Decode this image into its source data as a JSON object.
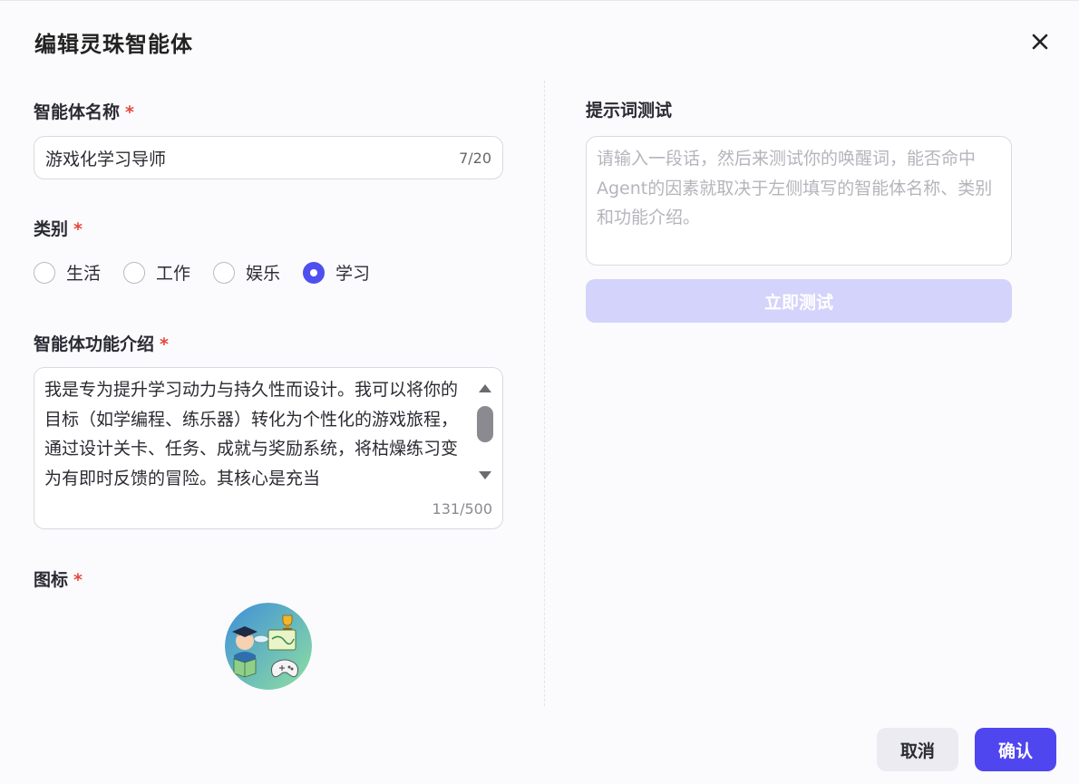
{
  "dialog": {
    "title": "编辑灵珠智能体",
    "close_icon": "close-icon"
  },
  "form": {
    "name": {
      "label": "智能体名称",
      "required_mark": "*",
      "value": "游戏化学习导师",
      "counter": "7/20"
    },
    "category": {
      "label": "类别",
      "required_mark": "*",
      "options": [
        "生活",
        "工作",
        "娱乐",
        "学习"
      ],
      "selected": "学习"
    },
    "description": {
      "label": "智能体功能介绍",
      "required_mark": "*",
      "value": "我是专为提升学习动力与持久性而设计。我可以将你的目标（如学编程、练乐器）转化为个性化的游戏旅程，通过设计关卡、任务、成就与奖励系统，将枯燥练习变为有即时反馈的冒险。其核心是充当",
      "counter": "131/500"
    },
    "icon": {
      "label": "图标",
      "required_mark": "*",
      "image": "avatar-graduate-gaming-illustration"
    }
  },
  "prompt_test": {
    "label": "提示词测试",
    "placeholder": "请输入一段话，然后来测试你的唤醒词，能否命中Agent的因素就取决于左侧填写的智能体名称、类别和功能介绍。",
    "button": "立即测试"
  },
  "footer": {
    "cancel": "取消",
    "confirm": "确认"
  },
  "colors": {
    "accent": "#4f46f0",
    "required": "#e5483d",
    "disabled_button": "#d4d3fb"
  }
}
